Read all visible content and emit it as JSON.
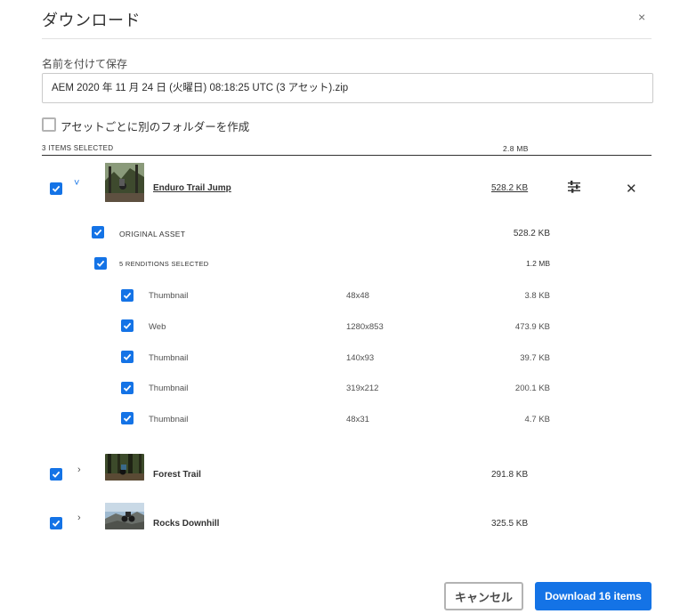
{
  "dialog": {
    "title": "ダウンロード",
    "close_glyph": "×",
    "save_as_label": "名前を付けて保存",
    "filename_value": "AEM 2020 年 11 月 24 日 (火曜日) 08:18:25 UTC (3 アセット).zip",
    "separate_folder_label": "アセットごとに別のフォルダーを作成",
    "separate_folder_checked": false
  },
  "summary": {
    "items_selected": "3 ITEMS SELECTED",
    "total_size": "2.8 MB"
  },
  "assets": [
    {
      "name": "Enduro Trail Jump",
      "size": "528.2 KB",
      "checked": true,
      "expanded": true,
      "original_label": "ORIGINAL ASSET",
      "original_size": "528.2 KB",
      "renditions_label": "5 RENDITIONS SELECTED",
      "renditions_size": "1.2 MB",
      "renditions": [
        {
          "name": "Thumbnail",
          "dims": "48x48",
          "size": "3.8 KB"
        },
        {
          "name": "Web",
          "dims": "1280x853",
          "size": "473.9 KB"
        },
        {
          "name": "Thumbnail",
          "dims": "140x93",
          "size": "39.7 KB"
        },
        {
          "name": "Thumbnail",
          "dims": "319x212",
          "size": "200.1 KB"
        },
        {
          "name": "Thumbnail",
          "dims": "48x31",
          "size": "4.7 KB"
        }
      ]
    },
    {
      "name": "Forest Trail",
      "size": "291.8 KB",
      "checked": true,
      "expanded": false
    },
    {
      "name": "Rocks Downhill",
      "size": "325.5 KB",
      "checked": true,
      "expanded": false
    }
  ],
  "buttons": {
    "cancel": "キャンセル",
    "download": "Download 16 items"
  },
  "icons": {
    "chevron_expanded": "˅",
    "chevron_collapsed": "›",
    "remove": "✕"
  },
  "colors": {
    "accent": "#1473e6"
  }
}
